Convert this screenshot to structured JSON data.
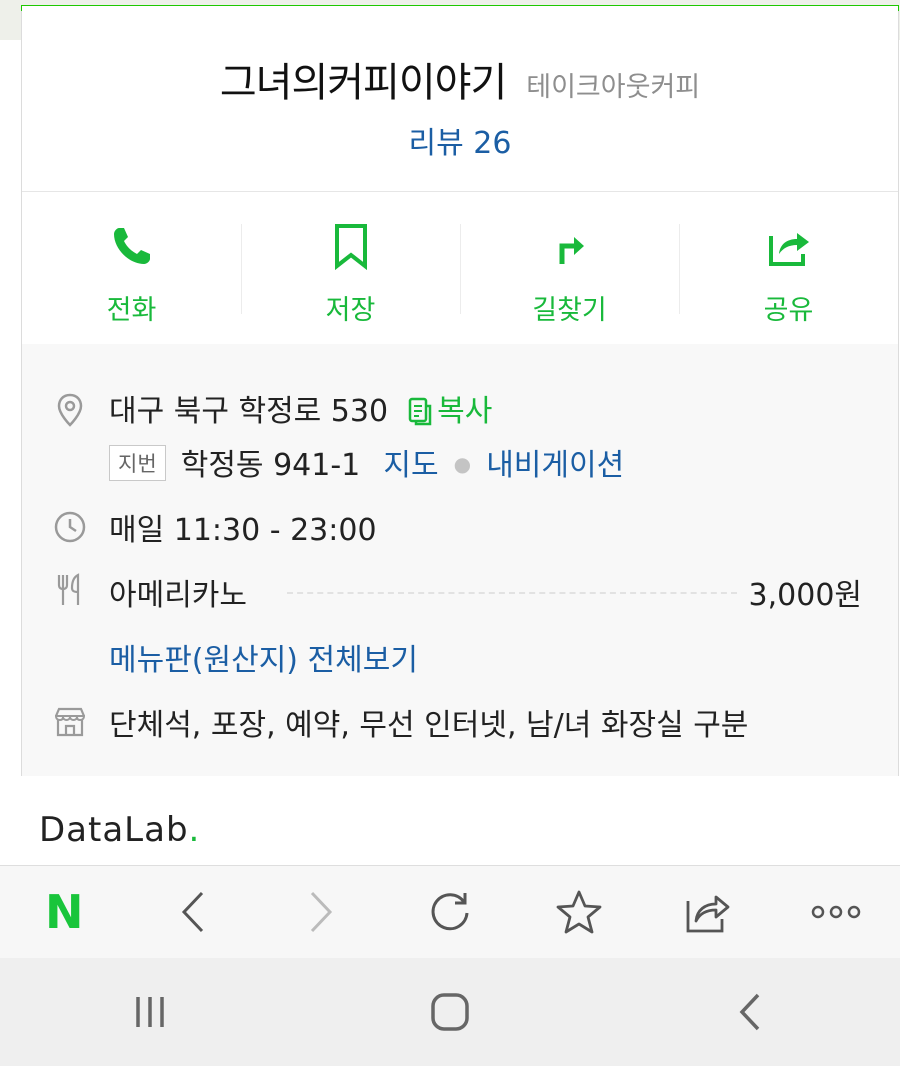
{
  "place": {
    "name": "그녀의커피이야기",
    "category": "테이크아웃커피",
    "review_label": "리뷰 26"
  },
  "actions": [
    {
      "label": "전화",
      "icon": "phone-icon"
    },
    {
      "label": "저장",
      "icon": "bookmark-icon"
    },
    {
      "label": "길찾기",
      "icon": "directions-icon"
    },
    {
      "label": "공유",
      "icon": "share-icon"
    }
  ],
  "info": {
    "address": "대구 북구 학정로 530",
    "copy_label": "복사",
    "jibeon_badge": "지번",
    "jibeon_address": "학정동 941-1",
    "map_link": "지도",
    "nav_link": "내비게이션",
    "hours": "매일 11:30 - 23:00",
    "menu_item": "아메리카노",
    "menu_price": "3,000원",
    "menu_all_link": "메뉴판(원산지) 전체보기",
    "amenities": "단체석, 포장, 예약, 무선 인터넷, 남/녀 화장실 구분"
  },
  "footer": {
    "datalab": "DataLab",
    "datalab_dot": "."
  },
  "browser_bar": {
    "home_logo": "N",
    "items": [
      "naver-home",
      "back-icon",
      "forward-icon",
      "refresh-icon",
      "star-icon",
      "share-icon",
      "more-icon"
    ]
  },
  "colors": {
    "accent_green": "#19b93b",
    "link_blue": "#1b5ea4",
    "top_bar_green": "#1ec800"
  }
}
